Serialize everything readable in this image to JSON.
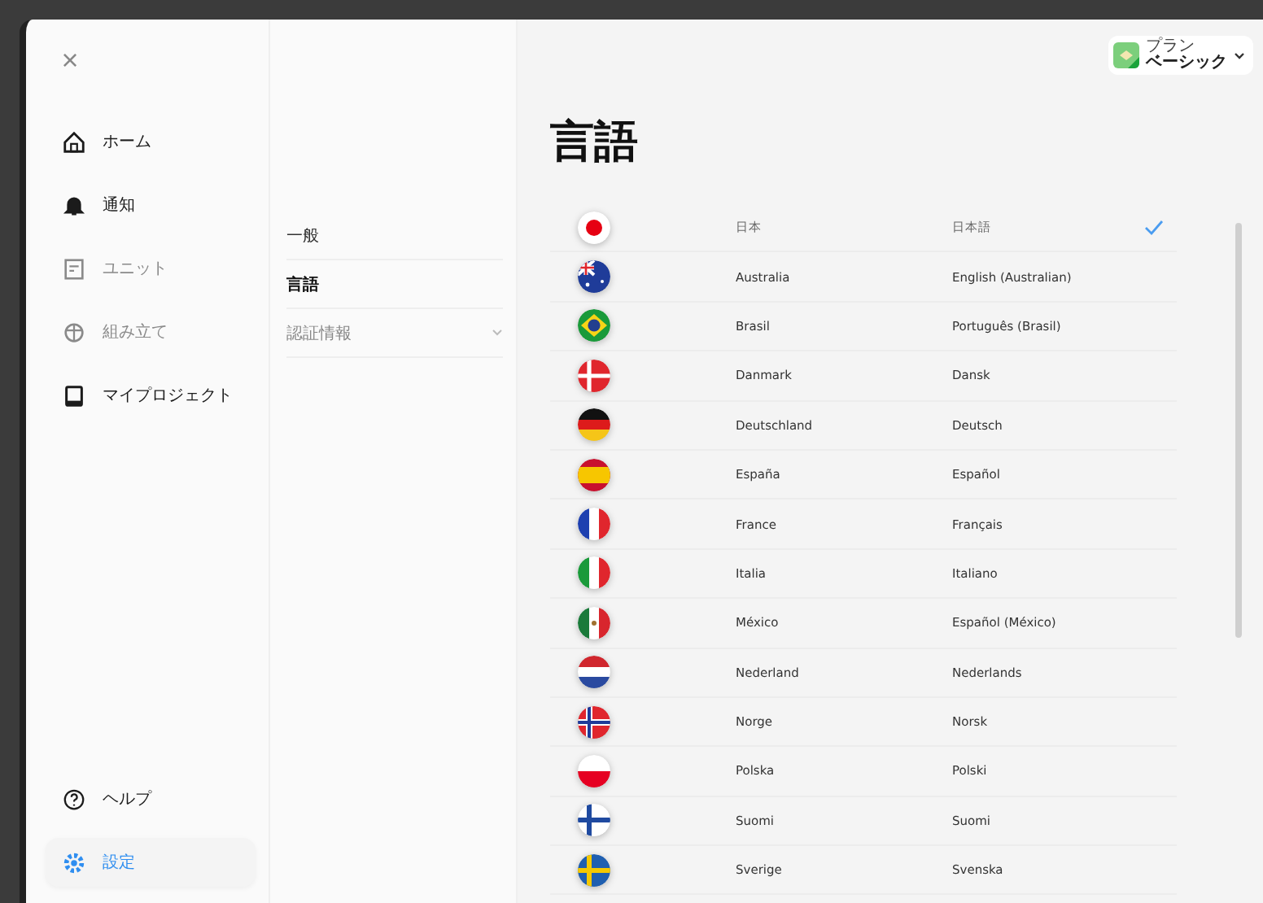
{
  "window": {
    "close": "×"
  },
  "sidebar": {
    "items": [
      {
        "label": "ホーム",
        "kind": "home",
        "selected": false,
        "disabled": false
      },
      {
        "label": "通知",
        "kind": "bell",
        "selected": false,
        "disabled": false
      },
      {
        "label": "ユニット",
        "kind": "unit",
        "selected": false,
        "disabled": true
      },
      {
        "label": "組み立て",
        "kind": "box",
        "selected": false,
        "disabled": true
      },
      {
        "label": "マイプロジェクト",
        "kind": "tablet",
        "selected": false,
        "disabled": false
      }
    ],
    "bottom_items": [
      {
        "label": "ヘルプ",
        "kind": "help",
        "selected": false,
        "disabled": false
      },
      {
        "label": "設定",
        "kind": "gear",
        "selected": true,
        "disabled": false
      }
    ]
  },
  "settings_menu": {
    "items": [
      {
        "label": "一般",
        "kind": "link",
        "selected": false
      },
      {
        "label": "言語",
        "kind": "link",
        "selected": true
      },
      {
        "label": "認証情報",
        "kind": "dropdown",
        "selected": false
      }
    ]
  },
  "plan": {
    "caption": "プラン",
    "name": "ベーシック"
  },
  "title": "言語",
  "languages": [
    {
      "kind": "jp",
      "country": "日本",
      "language": "日本語",
      "selected": true
    },
    {
      "kind": "au",
      "country": "Australia",
      "language": "English (Australian)",
      "selected": false
    },
    {
      "kind": "br",
      "country": "Brasil",
      "language": "Português (Brasil)",
      "selected": false
    },
    {
      "kind": "dk",
      "country": "Danmark",
      "language": "Dansk",
      "selected": false
    },
    {
      "kind": "de",
      "country": "Deutschland",
      "language": "Deutsch",
      "selected": false
    },
    {
      "kind": "es",
      "country": "España",
      "language": "Español",
      "selected": false
    },
    {
      "kind": "fr",
      "country": "France",
      "language": "Français",
      "selected": false
    },
    {
      "kind": "it",
      "country": "Italia",
      "language": "Italiano",
      "selected": false
    },
    {
      "kind": "mx",
      "country": "México",
      "language": "Español (México)",
      "selected": false
    },
    {
      "kind": "nl",
      "country": "Nederland",
      "language": "Nederlands",
      "selected": false
    },
    {
      "kind": "no",
      "country": "Norge",
      "language": "Norsk",
      "selected": false
    },
    {
      "kind": "pl",
      "country": "Polska",
      "language": "Polski",
      "selected": false
    },
    {
      "kind": "fi",
      "country": "Suomi",
      "language": "Suomi",
      "selected": false
    },
    {
      "kind": "se",
      "country": "Sverige",
      "language": "Svenska",
      "selected": false
    }
  ]
}
